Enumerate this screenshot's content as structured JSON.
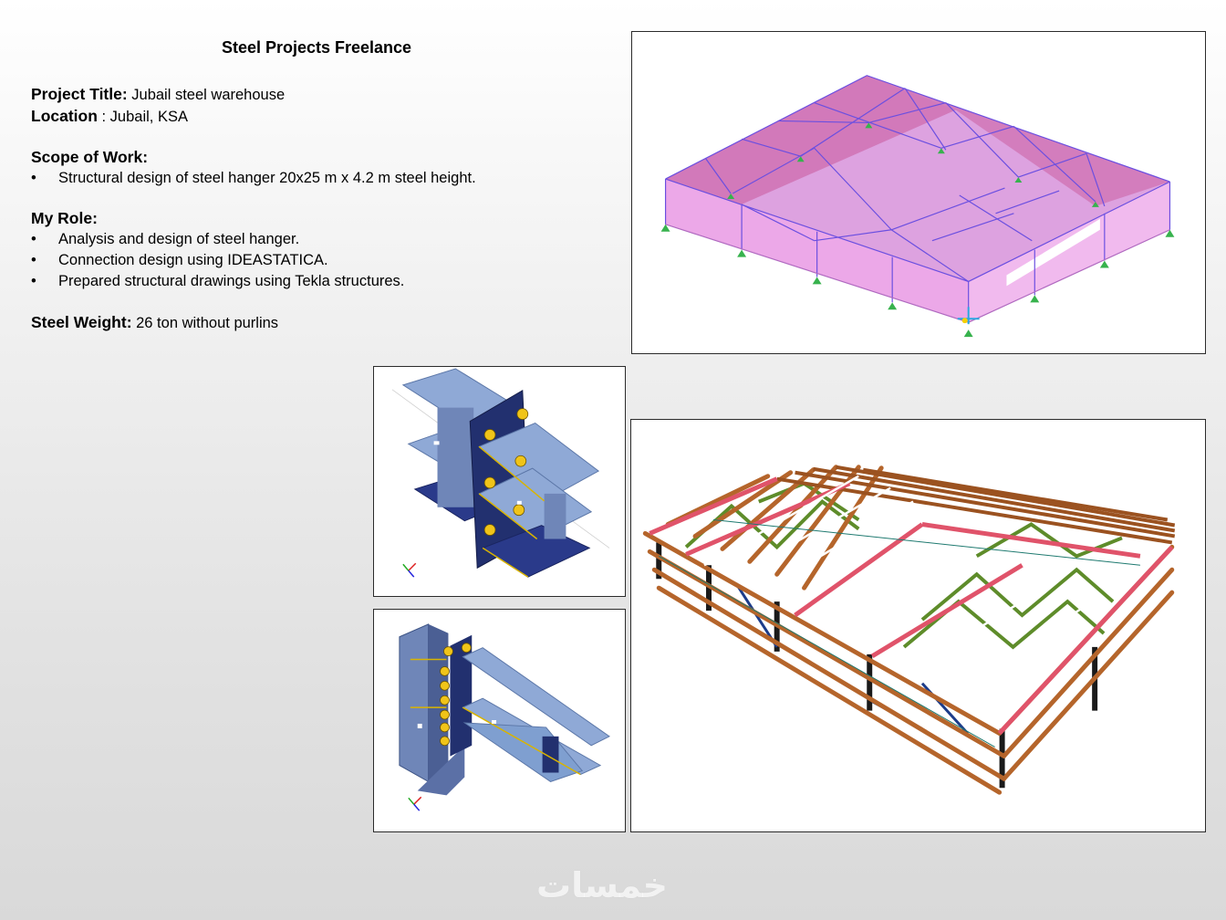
{
  "title": "Steel Projects Freelance",
  "project": {
    "title_label": "Project Title:",
    "title_value": "Jubail steel warehouse",
    "location_label": "Location",
    "location_value": " : Jubail, KSA"
  },
  "scope": {
    "heading": "Scope of Work:",
    "items": [
      "Structural design of steel hanger 20x25 m  x 4.2 m steel height."
    ]
  },
  "role": {
    "heading": "My Role:",
    "items": [
      "Analysis and design of steel hanger.",
      "Connection design using IDEASTATICA.",
      "Prepared structural drawings using Tekla structures."
    ]
  },
  "weight": {
    "label": "Steel Weight:",
    "value": " 26 ton without purlins"
  },
  "watermark": "خمسات",
  "colors": {
    "analysis_fill": "#e9a4e6",
    "analysis_members": "#6b4fe0",
    "support": "#37b24d",
    "connection_steel": "#7f9fd0",
    "connection_plate": "#1f2f6e",
    "bolt": "#f0c419",
    "tekla_purlin": "#b5652b",
    "tekla_rafter": "#e0536a",
    "tekla_bracing": "#5e8c2a",
    "tekla_column": "#1a1a1a"
  }
}
